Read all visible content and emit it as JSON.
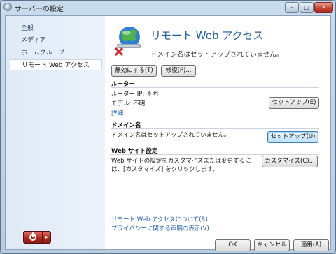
{
  "window": {
    "title": "サーバーの設定"
  },
  "sidebar": {
    "items": [
      {
        "label": "全般"
      },
      {
        "label": "メディア"
      },
      {
        "label": "ホームグループ"
      },
      {
        "label": "リモート Web アクセス"
      }
    ]
  },
  "header": {
    "title": "リモート Web アクセス",
    "subtitle": "ドメイン名はセットアップされていません。"
  },
  "actions": {
    "disable": "無効にする(T)",
    "repair": "修復(P)..."
  },
  "router": {
    "title": "ルーター",
    "ip": "ルーター IP: 不明",
    "model": "モデル: 不明",
    "details": "詳細",
    "setup": "セットアップ(E)"
  },
  "domain": {
    "title": "ドメイン名",
    "status": "ドメイン名はセットアップされていません。",
    "setup": "セットアップ(U)"
  },
  "website": {
    "title": "Web サイト設定",
    "desc1": "Web サイトの設定をカスタマイズまたは変更するに",
    "desc2": "は、[カスタマイズ] をクリックします。",
    "customize": "カスタマイズ(C)..."
  },
  "links": {
    "about": "リモート Web アクセスについて(R)",
    "privacy": "プライバシーに関する声明の表示(V)"
  },
  "footer": {
    "ok": "OK",
    "cancel": "キャンセル",
    "apply": "適用(A)"
  },
  "icons": {
    "power": "power-icon",
    "power_arrow": "▸"
  },
  "colors": {
    "accent": "#1d5aa0",
    "link": "#1b5fb5",
    "error": "#d22222"
  }
}
